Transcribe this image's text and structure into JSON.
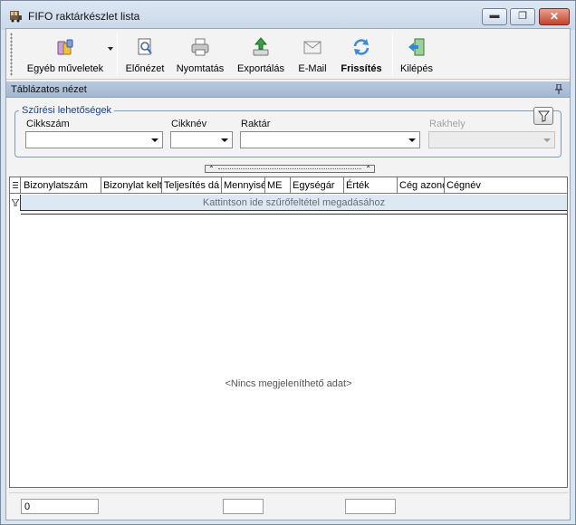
{
  "window": {
    "title": "FIFO raktárkészlet lista"
  },
  "toolbar": {
    "other_ops": "Egyéb műveletek",
    "preview": "Előnézet",
    "print": "Nyomtatás",
    "export": "Exportálás",
    "email": "E-Mail",
    "refresh": "Frissítés",
    "exit": "Kilépés"
  },
  "panel": {
    "title": "Táblázatos nézet"
  },
  "filters": {
    "legend": "Szűrési lehetőségek",
    "item_no": {
      "label": "Cikkszám",
      "value": ""
    },
    "item_name": {
      "label": "Cikknév",
      "value": ""
    },
    "warehouse": {
      "label": "Raktár",
      "value": ""
    },
    "location": {
      "label": "Rakhely",
      "value": ""
    }
  },
  "grid": {
    "columns": [
      "Bizonylatszám",
      "Bizonylat kelt",
      "Teljesítés dá",
      "Mennyisé",
      "ME",
      "Egységár",
      "Érték",
      "Cég azonc",
      "Cégnév"
    ],
    "filter_row_hint": "Kattintson ide szűrőfeltétel megadásához",
    "empty_message": "<Nincs megjeleníthető adat>"
  },
  "statusbar": {
    "count": "0",
    "field2": "",
    "field3": ""
  },
  "colors": {
    "title_bg": "#c9d8ea",
    "panel_header": "#a4b8d2",
    "filter_row": "#dce9f5",
    "legend_text": "#1b3f8b"
  }
}
